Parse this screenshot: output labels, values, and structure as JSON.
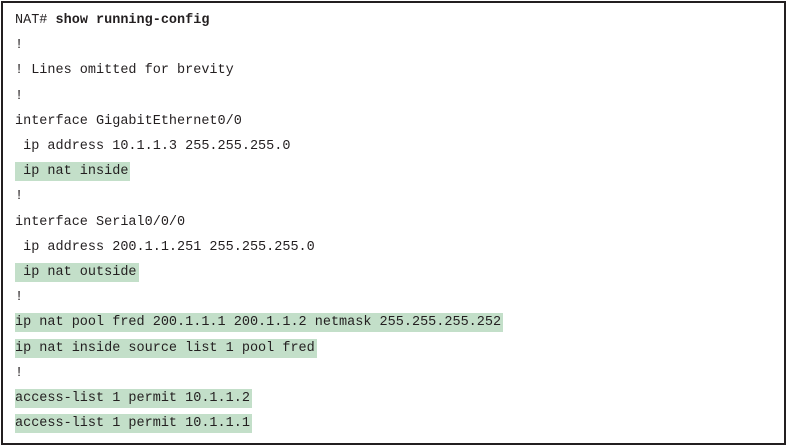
{
  "prompt": "NAT#",
  "command": "show running-config",
  "lines": [
    {
      "text": "!",
      "highlighted": false
    },
    {
      "text": "! Lines omitted for brevity",
      "highlighted": false
    },
    {
      "text": "!",
      "highlighted": false
    },
    {
      "text": "interface GigabitEthernet0/0",
      "highlighted": false
    },
    {
      "text": " ip address 10.1.1.3 255.255.255.0",
      "highlighted": false
    },
    {
      "text": " ip nat inside",
      "highlighted": true
    },
    {
      "text": "!",
      "highlighted": false
    },
    {
      "text": "interface Serial0/0/0",
      "highlighted": false
    },
    {
      "text": " ip address 200.1.1.251 255.255.255.0",
      "highlighted": false
    },
    {
      "text": " ip nat outside",
      "highlighted": true
    },
    {
      "text": "!",
      "highlighted": false
    },
    {
      "text": "ip nat pool fred 200.1.1.1 200.1.1.2 netmask 255.255.255.252",
      "highlighted": true
    },
    {
      "text": "ip nat inside source list 1 pool fred",
      "highlighted": true
    },
    {
      "text": "!",
      "highlighted": false
    },
    {
      "text": "access-list 1 permit 10.1.1.2",
      "highlighted": true
    },
    {
      "text": "access-list 1 permit 10.1.1.1",
      "highlighted": true
    }
  ],
  "colors": {
    "highlight": "#c3dfc9",
    "text": "#231f20",
    "border": "#231f20"
  }
}
